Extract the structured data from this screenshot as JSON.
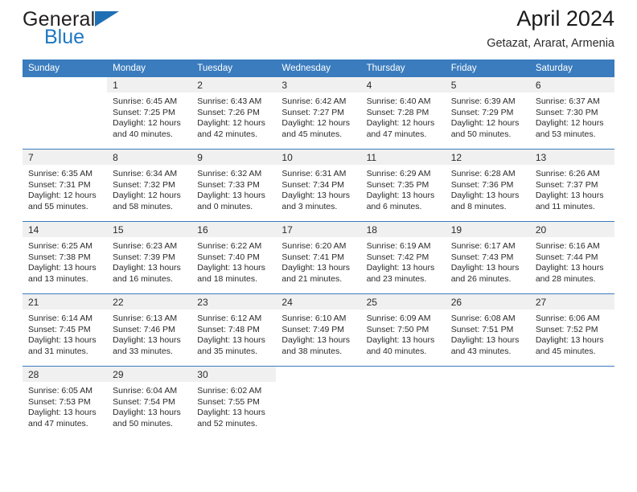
{
  "brand": {
    "name_part1": "General",
    "name_part2": "Blue",
    "triangle_icon": "triangle-icon",
    "colors": {
      "dark": "#231f20",
      "blue": "#1f77c2"
    }
  },
  "header": {
    "title": "April 2024",
    "subtitle": "Getazat, Ararat, Armenia"
  },
  "calendar": {
    "accent_color": "#3a7cbe",
    "daynum_bg": "#f0f0f0",
    "weekday_headers": [
      "Sunday",
      "Monday",
      "Tuesday",
      "Wednesday",
      "Thursday",
      "Friday",
      "Saturday"
    ],
    "weeks": [
      [
        {
          "day": "",
          "blank": true,
          "sunrise": "",
          "sunset": "",
          "daylight_line1": "",
          "daylight_line2": ""
        },
        {
          "day": "1",
          "sunrise": "Sunrise: 6:45 AM",
          "sunset": "Sunset: 7:25 PM",
          "daylight_line1": "Daylight: 12 hours",
          "daylight_line2": "and 40 minutes."
        },
        {
          "day": "2",
          "sunrise": "Sunrise: 6:43 AM",
          "sunset": "Sunset: 7:26 PM",
          "daylight_line1": "Daylight: 12 hours",
          "daylight_line2": "and 42 minutes."
        },
        {
          "day": "3",
          "sunrise": "Sunrise: 6:42 AM",
          "sunset": "Sunset: 7:27 PM",
          "daylight_line1": "Daylight: 12 hours",
          "daylight_line2": "and 45 minutes."
        },
        {
          "day": "4",
          "sunrise": "Sunrise: 6:40 AM",
          "sunset": "Sunset: 7:28 PM",
          "daylight_line1": "Daylight: 12 hours",
          "daylight_line2": "and 47 minutes."
        },
        {
          "day": "5",
          "sunrise": "Sunrise: 6:39 AM",
          "sunset": "Sunset: 7:29 PM",
          "daylight_line1": "Daylight: 12 hours",
          "daylight_line2": "and 50 minutes."
        },
        {
          "day": "6",
          "sunrise": "Sunrise: 6:37 AM",
          "sunset": "Sunset: 7:30 PM",
          "daylight_line1": "Daylight: 12 hours",
          "daylight_line2": "and 53 minutes."
        }
      ],
      [
        {
          "day": "7",
          "sunrise": "Sunrise: 6:35 AM",
          "sunset": "Sunset: 7:31 PM",
          "daylight_line1": "Daylight: 12 hours",
          "daylight_line2": "and 55 minutes."
        },
        {
          "day": "8",
          "sunrise": "Sunrise: 6:34 AM",
          "sunset": "Sunset: 7:32 PM",
          "daylight_line1": "Daylight: 12 hours",
          "daylight_line2": "and 58 minutes."
        },
        {
          "day": "9",
          "sunrise": "Sunrise: 6:32 AM",
          "sunset": "Sunset: 7:33 PM",
          "daylight_line1": "Daylight: 13 hours",
          "daylight_line2": "and 0 minutes."
        },
        {
          "day": "10",
          "sunrise": "Sunrise: 6:31 AM",
          "sunset": "Sunset: 7:34 PM",
          "daylight_line1": "Daylight: 13 hours",
          "daylight_line2": "and 3 minutes."
        },
        {
          "day": "11",
          "sunrise": "Sunrise: 6:29 AM",
          "sunset": "Sunset: 7:35 PM",
          "daylight_line1": "Daylight: 13 hours",
          "daylight_line2": "and 6 minutes."
        },
        {
          "day": "12",
          "sunrise": "Sunrise: 6:28 AM",
          "sunset": "Sunset: 7:36 PM",
          "daylight_line1": "Daylight: 13 hours",
          "daylight_line2": "and 8 minutes."
        },
        {
          "day": "13",
          "sunrise": "Sunrise: 6:26 AM",
          "sunset": "Sunset: 7:37 PM",
          "daylight_line1": "Daylight: 13 hours",
          "daylight_line2": "and 11 minutes."
        }
      ],
      [
        {
          "day": "14",
          "sunrise": "Sunrise: 6:25 AM",
          "sunset": "Sunset: 7:38 PM",
          "daylight_line1": "Daylight: 13 hours",
          "daylight_line2": "and 13 minutes."
        },
        {
          "day": "15",
          "sunrise": "Sunrise: 6:23 AM",
          "sunset": "Sunset: 7:39 PM",
          "daylight_line1": "Daylight: 13 hours",
          "daylight_line2": "and 16 minutes."
        },
        {
          "day": "16",
          "sunrise": "Sunrise: 6:22 AM",
          "sunset": "Sunset: 7:40 PM",
          "daylight_line1": "Daylight: 13 hours",
          "daylight_line2": "and 18 minutes."
        },
        {
          "day": "17",
          "sunrise": "Sunrise: 6:20 AM",
          "sunset": "Sunset: 7:41 PM",
          "daylight_line1": "Daylight: 13 hours",
          "daylight_line2": "and 21 minutes."
        },
        {
          "day": "18",
          "sunrise": "Sunrise: 6:19 AM",
          "sunset": "Sunset: 7:42 PM",
          "daylight_line1": "Daylight: 13 hours",
          "daylight_line2": "and 23 minutes."
        },
        {
          "day": "19",
          "sunrise": "Sunrise: 6:17 AM",
          "sunset": "Sunset: 7:43 PM",
          "daylight_line1": "Daylight: 13 hours",
          "daylight_line2": "and 26 minutes."
        },
        {
          "day": "20",
          "sunrise": "Sunrise: 6:16 AM",
          "sunset": "Sunset: 7:44 PM",
          "daylight_line1": "Daylight: 13 hours",
          "daylight_line2": "and 28 minutes."
        }
      ],
      [
        {
          "day": "21",
          "sunrise": "Sunrise: 6:14 AM",
          "sunset": "Sunset: 7:45 PM",
          "daylight_line1": "Daylight: 13 hours",
          "daylight_line2": "and 31 minutes."
        },
        {
          "day": "22",
          "sunrise": "Sunrise: 6:13 AM",
          "sunset": "Sunset: 7:46 PM",
          "daylight_line1": "Daylight: 13 hours",
          "daylight_line2": "and 33 minutes."
        },
        {
          "day": "23",
          "sunrise": "Sunrise: 6:12 AM",
          "sunset": "Sunset: 7:48 PM",
          "daylight_line1": "Daylight: 13 hours",
          "daylight_line2": "and 35 minutes."
        },
        {
          "day": "24",
          "sunrise": "Sunrise: 6:10 AM",
          "sunset": "Sunset: 7:49 PM",
          "daylight_line1": "Daylight: 13 hours",
          "daylight_line2": "and 38 minutes."
        },
        {
          "day": "25",
          "sunrise": "Sunrise: 6:09 AM",
          "sunset": "Sunset: 7:50 PM",
          "daylight_line1": "Daylight: 13 hours",
          "daylight_line2": "and 40 minutes."
        },
        {
          "day": "26",
          "sunrise": "Sunrise: 6:08 AM",
          "sunset": "Sunset: 7:51 PM",
          "daylight_line1": "Daylight: 13 hours",
          "daylight_line2": "and 43 minutes."
        },
        {
          "day": "27",
          "sunrise": "Sunrise: 6:06 AM",
          "sunset": "Sunset: 7:52 PM",
          "daylight_line1": "Daylight: 13 hours",
          "daylight_line2": "and 45 minutes."
        }
      ],
      [
        {
          "day": "28",
          "sunrise": "Sunrise: 6:05 AM",
          "sunset": "Sunset: 7:53 PM",
          "daylight_line1": "Daylight: 13 hours",
          "daylight_line2": "and 47 minutes."
        },
        {
          "day": "29",
          "sunrise": "Sunrise: 6:04 AM",
          "sunset": "Sunset: 7:54 PM",
          "daylight_line1": "Daylight: 13 hours",
          "daylight_line2": "and 50 minutes."
        },
        {
          "day": "30",
          "sunrise": "Sunrise: 6:02 AM",
          "sunset": "Sunset: 7:55 PM",
          "daylight_line1": "Daylight: 13 hours",
          "daylight_line2": "and 52 minutes."
        },
        {
          "day": "",
          "blank": true,
          "sunrise": "",
          "sunset": "",
          "daylight_line1": "",
          "daylight_line2": ""
        },
        {
          "day": "",
          "blank": true,
          "sunrise": "",
          "sunset": "",
          "daylight_line1": "",
          "daylight_line2": ""
        },
        {
          "day": "",
          "blank": true,
          "sunrise": "",
          "sunset": "",
          "daylight_line1": "",
          "daylight_line2": ""
        },
        {
          "day": "",
          "blank": true,
          "sunrise": "",
          "sunset": "",
          "daylight_line1": "",
          "daylight_line2": ""
        }
      ]
    ]
  }
}
